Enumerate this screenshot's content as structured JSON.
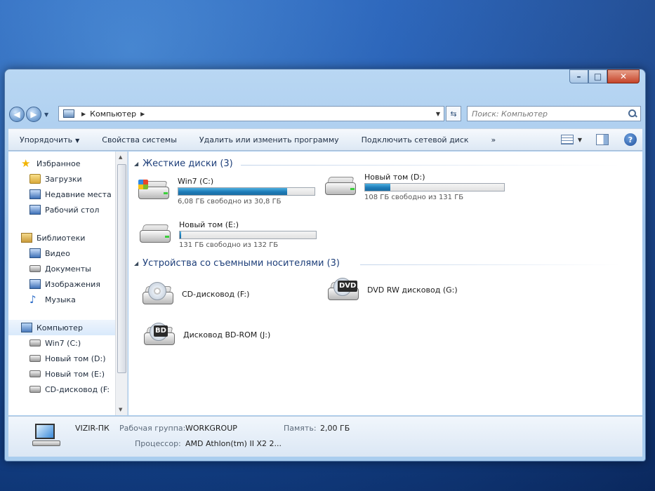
{
  "nav": {
    "address": [
      "Компьютер"
    ],
    "search_placeholder": "Поиск: Компьютер"
  },
  "toolbar": {
    "organize": "Упорядочить",
    "system_properties": "Свойства системы",
    "uninstall": "Удалить или изменить программу",
    "map_drive": "Подключить сетевой диск",
    "more": "»"
  },
  "sidebar": {
    "favorites": {
      "label": "Избранное",
      "items": [
        "Загрузки",
        "Недавние места",
        "Рабочий стол"
      ]
    },
    "libraries": {
      "label": "Библиотеки",
      "items": [
        "Видео",
        "Документы",
        "Изображения",
        "Музыка"
      ]
    },
    "computer": {
      "label": "Компьютер",
      "items": [
        "Win7 (C:)",
        "Новый том (D:)",
        "Новый том (E:)",
        "CD-дисковод (F:"
      ]
    }
  },
  "hard_drives": {
    "title": "Жесткие диски (3)",
    "items": [
      {
        "name": "Win7 (C:)",
        "free": "6,08 ГБ свободно из 30,8 ГБ",
        "used_fraction": 0.8,
        "system": true
      },
      {
        "name": "Новый том (D:)",
        "free": "108 ГБ свободно из 131 ГБ",
        "used_fraction": 0.18
      },
      {
        "name": "Новый том (E:)",
        "free": "131 ГБ свободно из 132 ГБ",
        "used_fraction": 0.01
      }
    ]
  },
  "removable": {
    "title": "Устройства со съемными носителями (3)",
    "items": [
      {
        "name": "CD-дисковод (F:)"
      },
      {
        "name": "DVD RW дисковод (G:)",
        "badge": "DVD"
      },
      {
        "name": "Дисковод BD-ROM (J:)",
        "badge": "BD"
      }
    ]
  },
  "details": {
    "pc_name": "VIZIR-ПК",
    "workgroup_label": "Рабочая группа:",
    "workgroup": "WORKGROUP",
    "memory_label": "Память:",
    "memory": "2,00 ГБ",
    "cpu_label": "Процессор:",
    "cpu": "AMD Athlon(tm) II X2 2..."
  },
  "window": {
    "minimize": "–",
    "maximize": "□",
    "close": "✕"
  }
}
